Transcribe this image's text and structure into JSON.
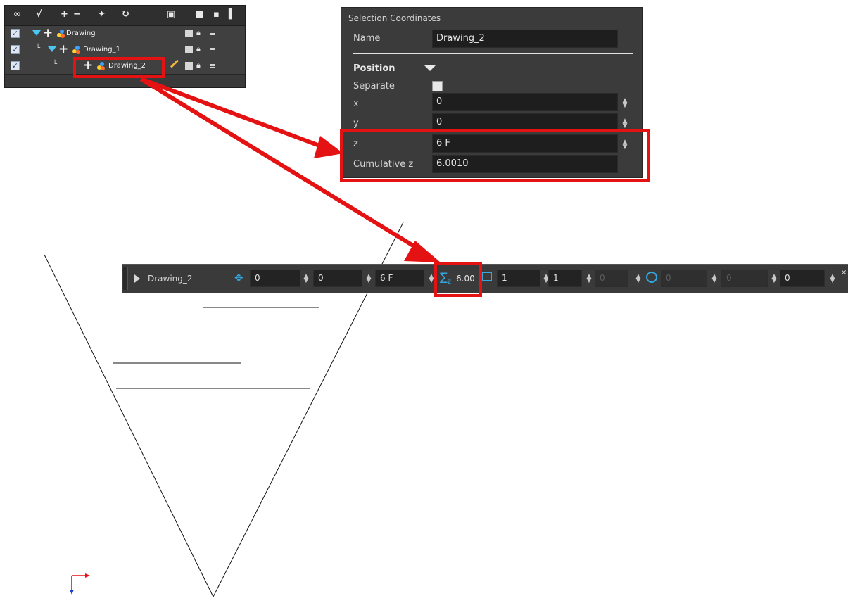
{
  "timeline": {
    "layers": [
      {
        "name": "Drawing",
        "checked": true
      },
      {
        "name": "Drawing_1",
        "checked": true
      },
      {
        "name": "Drawing_2",
        "checked": true
      }
    ]
  },
  "selection_coordinates": {
    "title": "Selection Coordinates",
    "name_label": "Name",
    "name_value": "Drawing_2",
    "position_label": "Position",
    "separate_label": "Separate",
    "x_label": "x",
    "x_value": "0",
    "y_label": "y",
    "y_value": "0",
    "z_label": "z",
    "z_value": "6 F",
    "cumulative_z_label": "Cumulative z",
    "cumulative_z_value": "6.0010"
  },
  "properties_bar": {
    "layer_name": "Drawing_2",
    "x_value": "0",
    "y_value": "0",
    "z_value": "6 F",
    "cumulative_z_value": "6.00",
    "scale_x_value": "1",
    "scale_y_value": "1",
    "scale_z_value": "0",
    "rotation_value": "0",
    "skew_value": "0",
    "extra_value": "0"
  },
  "colors": {
    "highlight": "#e41212",
    "accent_blue": "#35a8e0",
    "panel_bg": "#3b3b3b"
  },
  "icons": [
    "onion-skin-icon",
    "add-layer-icon",
    "remove-layer-icon",
    "peg-icon",
    "zoom-fit-icon",
    "expand-triangle-icon",
    "lock-icon",
    "layer-stack-icon",
    "position-icon",
    "cumulative-sigma-icon",
    "scale-icon",
    "rotation-icon",
    "axis-origin-icon"
  ]
}
